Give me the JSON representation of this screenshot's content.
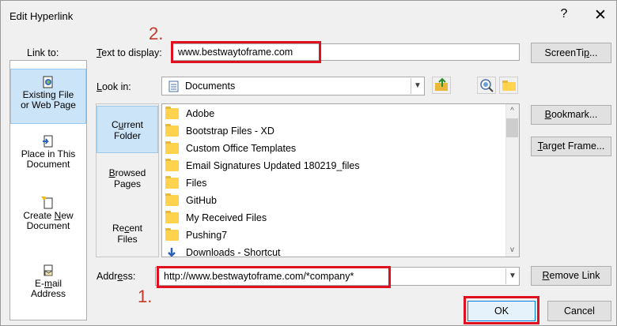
{
  "window": {
    "title": "Edit Hyperlink",
    "help_glyph": "?",
    "close_glyph": "✕"
  },
  "link_to": {
    "label": "Link to:",
    "items": [
      {
        "label_a": "Existing File",
        "label_b": "or Web Page",
        "icon": "existing-file-icon",
        "selected": true
      },
      {
        "label_a": "Place in This",
        "label_b": "Document",
        "icon": "place-in-document-icon",
        "selected": false
      },
      {
        "label_a": "Create New",
        "label_b": "Document",
        "icon": "create-new-document-icon",
        "selected": false
      },
      {
        "label_a": "E-mail",
        "label_b": "Address",
        "icon": "email-address-icon",
        "selected": false
      }
    ]
  },
  "text_to_display": {
    "label": "Text to display:",
    "value": "www.bestwaytoframe.com"
  },
  "screentip_button": "ScreenTip...",
  "look_in": {
    "label": "Look in:",
    "value": "Documents"
  },
  "subnav": [
    {
      "line1": "Current",
      "line2": "Folder",
      "selected": true
    },
    {
      "line1": "Browsed",
      "line2": "Pages",
      "selected": false
    },
    {
      "line1": "Recent",
      "line2": "Files",
      "selected": false
    }
  ],
  "files": [
    "Adobe",
    "Bootstrap Files - XD",
    "Custom Office Templates",
    "Email Signatures Updated 180219_files",
    "Files",
    "GitHub",
    "My Received Files",
    "Pushing7",
    "Downloads - Shortcut"
  ],
  "bookmark_button": "Bookmark...",
  "target_frame_button": "Target Frame...",
  "address": {
    "label": "Address:",
    "value": "http://www.bestwaytoframe.com/*company*"
  },
  "remove_link_button": "Remove Link",
  "ok_button": "OK",
  "cancel_button": "Cancel",
  "annotations": {
    "step1": "1.",
    "step2": "2."
  },
  "colors": {
    "highlight_red": "#e01020",
    "annotation_text": "#c0392b",
    "selection_blue": "#cce4f7",
    "folder_yellow": "#ffd34e"
  }
}
